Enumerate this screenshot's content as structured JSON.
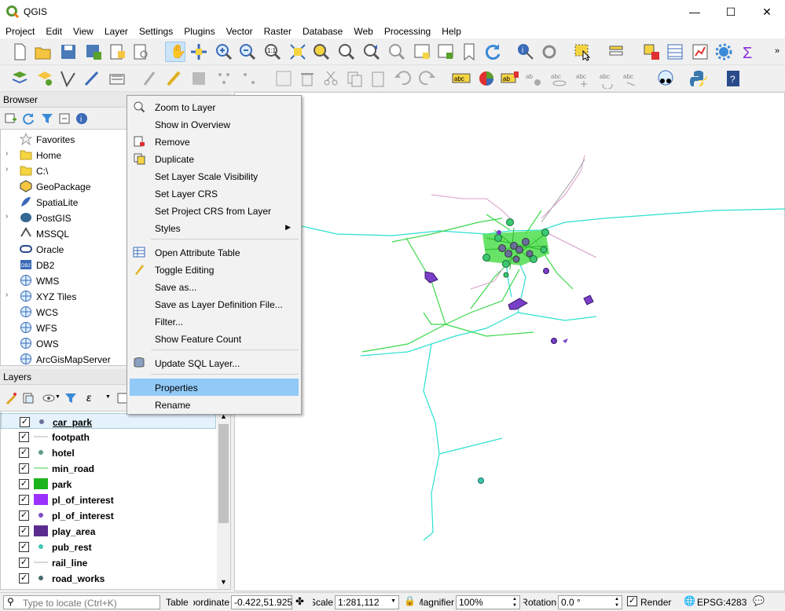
{
  "window": {
    "title": "QGIS",
    "minimize": "—",
    "maximize": "☐",
    "close": "✕"
  },
  "menu": [
    "Project",
    "Edit",
    "View",
    "Layer",
    "Settings",
    "Plugins",
    "Vector",
    "Raster",
    "Database",
    "Web",
    "Processing",
    "Help"
  ],
  "browser": {
    "title": "Browser",
    "items": [
      {
        "label": "Favorites",
        "icon": "star-icon",
        "expand": ""
      },
      {
        "label": "Home",
        "icon": "folder-icon",
        "expand": "›"
      },
      {
        "label": "C:\\",
        "icon": "folder-icon",
        "expand": "›"
      },
      {
        "label": "GeoPackage",
        "icon": "geopackage-icon",
        "expand": ""
      },
      {
        "label": "SpatiaLite",
        "icon": "spatialite-icon",
        "expand": ""
      },
      {
        "label": "PostGIS",
        "icon": "postgis-icon",
        "expand": "›"
      },
      {
        "label": "MSSQL",
        "icon": "mssql-icon",
        "expand": ""
      },
      {
        "label": "Oracle",
        "icon": "oracle-icon",
        "expand": ""
      },
      {
        "label": "DB2",
        "icon": "db2-icon",
        "expand": ""
      },
      {
        "label": "WMS",
        "icon": "globe-icon",
        "expand": ""
      },
      {
        "label": "XYZ Tiles",
        "icon": "tiles-icon",
        "expand": "›"
      },
      {
        "label": "WCS",
        "icon": "globe-icon",
        "expand": ""
      },
      {
        "label": "WFS",
        "icon": "globe-icon",
        "expand": ""
      },
      {
        "label": "OWS",
        "icon": "globe-icon",
        "expand": ""
      },
      {
        "label": "ArcGisMapServer",
        "icon": "globe-icon",
        "expand": ""
      }
    ]
  },
  "layers": {
    "title": "Layers",
    "items": [
      {
        "name": "car_park",
        "symbol": "point",
        "color": "#6b6e9c",
        "checked": "✓"
      },
      {
        "name": "footpath",
        "symbol": "line",
        "color": "#b0b0b0",
        "checked": "✓"
      },
      {
        "name": "hotel",
        "symbol": "point",
        "color": "#5a9e82",
        "checked": "✓"
      },
      {
        "name": "min_road",
        "symbol": "line",
        "color": "#3cc84a",
        "checked": "✓"
      },
      {
        "name": "park",
        "symbol": "fill",
        "color": "#1db31d",
        "checked": "✓"
      },
      {
        "name": "pl_of_interest",
        "symbol": "fill",
        "color": "#9b30ff",
        "checked": "✓"
      },
      {
        "name": "pl_of_interest",
        "symbol": "point",
        "color": "#7a4fc4",
        "checked": "✓"
      },
      {
        "name": "play_area",
        "symbol": "fill",
        "color": "#5b2c8e",
        "checked": "✓"
      },
      {
        "name": "pub_rest",
        "symbol": "point",
        "color": "#3cc8b4",
        "checked": "✓"
      },
      {
        "name": "rail_line",
        "symbol": "line",
        "color": "#b0b0b0",
        "checked": "✓"
      },
      {
        "name": "road_works",
        "symbol": "point",
        "color": "#4a6a6a",
        "checked": "✓"
      }
    ]
  },
  "context_menu": {
    "items": [
      {
        "label": "Zoom to Layer",
        "icon": "zoom-layer-icon",
        "submenu": ""
      },
      {
        "label": "Show in Overview",
        "icon": "",
        "submenu": ""
      },
      {
        "label": "Remove",
        "icon": "remove-layer-icon",
        "submenu": ""
      },
      {
        "label": "Duplicate",
        "icon": "duplicate-layer-icon",
        "submenu": ""
      },
      {
        "label": "Set Layer Scale Visibility",
        "icon": "",
        "submenu": ""
      },
      {
        "label": "Set Layer CRS",
        "icon": "",
        "submenu": ""
      },
      {
        "label": "Set Project CRS from Layer",
        "icon": "",
        "submenu": ""
      },
      {
        "label": "Styles",
        "icon": "",
        "submenu": "▶"
      },
      {
        "label": "Open Attribute Table",
        "icon": "attribute-table-icon",
        "submenu": ""
      },
      {
        "label": "Toggle Editing",
        "icon": "pencil-icon",
        "submenu": ""
      },
      {
        "label": "Save as...",
        "icon": "",
        "submenu": ""
      },
      {
        "label": "Save as Layer Definition File...",
        "icon": "",
        "submenu": ""
      },
      {
        "label": "Filter...",
        "icon": "",
        "submenu": ""
      },
      {
        "label": "Show Feature Count",
        "icon": "",
        "submenu": ""
      },
      {
        "label": "Update SQL Layer...",
        "icon": "database-icon",
        "submenu": ""
      },
      {
        "label": "Properties",
        "icon": "",
        "submenu": ""
      },
      {
        "label": "Rename",
        "icon": "",
        "submenu": ""
      }
    ]
  },
  "statusbar": {
    "locate_placeholder": "Type to locate (Ctrl+K)",
    "table": "Table",
    "coordinate_label": "Coordinate",
    "coordinate": "-0.422,51.925",
    "scale_label": "Scale",
    "scale": "1:281,112",
    "magnifier_label": "Magnifier",
    "magnifier": "100%",
    "rotation_label": "Rotation",
    "rotation": "0.0 °",
    "render": "Render",
    "crs": "EPSG:4283"
  },
  "colors": {
    "road_cyan": "#2de0d0",
    "road_green": "#3ad84a",
    "footpath_pink": "#d89bc8",
    "poi_purple": "#7a3fc8",
    "hotel_green": "#3cc870",
    "highlight": "#91c9f7"
  }
}
